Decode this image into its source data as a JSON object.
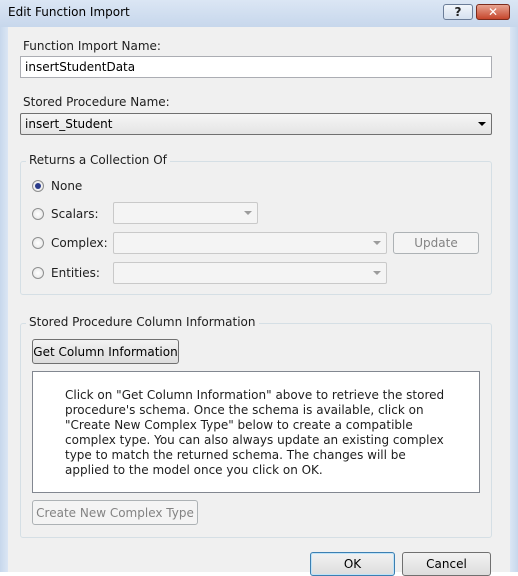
{
  "window": {
    "title": "Edit Function Import",
    "help_glyph": "?",
    "close_glyph": "✕"
  },
  "function_import": {
    "label": "Function Import Name:",
    "value": "insertStudentData"
  },
  "stored_procedure": {
    "label": "Stored Procedure Name:",
    "value": "insert_Student"
  },
  "returns_collection": {
    "legend": "Returns a Collection Of",
    "selected": "None",
    "options": {
      "none": "None",
      "scalars": "Scalars:",
      "complex": "Complex:",
      "entities": "Entities:"
    },
    "update_label": "Update"
  },
  "column_info": {
    "legend": "Stored Procedure Column Information",
    "get_button": "Get Column Information",
    "description": "Click on \"Get Column Information\" above to retrieve the stored procedure's schema. Once the schema is available, click on \"Create New Complex Type\" below to create a compatible complex type. You can also always update an existing complex type to match the returned schema. The changes will be applied to the model once you click on OK.",
    "create_button": "Create New Complex Type"
  },
  "footer": {
    "ok_label": "OK",
    "cancel_label": "Cancel"
  },
  "colors": {
    "title_bar": "#c7d7ec",
    "dialog_bg": "#f0f0f0",
    "close_button": "#c6462c"
  }
}
